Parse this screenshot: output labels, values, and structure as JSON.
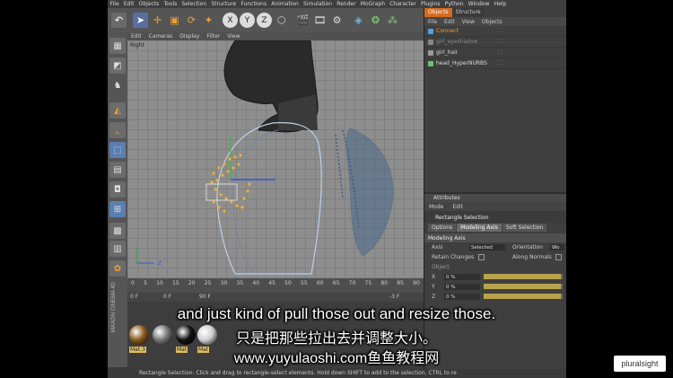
{
  "menubar": [
    "File",
    "Edit",
    "Objects",
    "Tools",
    "Selection",
    "Structure",
    "Functions",
    "Animation",
    "Simulation",
    "Render",
    "MoGraph",
    "Character",
    "Plugins",
    "Python",
    "Window",
    "Help"
  ],
  "viewport": {
    "menu": [
      "Edit",
      "Cameras",
      "Display",
      "Filter",
      "View"
    ],
    "label": "Right",
    "axis_label": "Z"
  },
  "timeline": {
    "ticks": [
      "0",
      "5",
      "10",
      "15",
      "20",
      "25",
      "30",
      "35",
      "40",
      "45",
      "50",
      "55",
      "60",
      "65",
      "70",
      "75",
      "80",
      "85",
      "90"
    ],
    "current_frame": "0 F",
    "start_field": "0 F",
    "end_field": "90 F",
    "right_readout": "-3 F"
  },
  "materials": [
    {
      "label": "Mat.3",
      "color": "#8a5a1e"
    },
    {
      "label": "",
      "color": "#777777"
    },
    {
      "label": "Mat",
      "color": "#111111"
    },
    {
      "label": "Mat",
      "color": "#d0d0d0"
    }
  ],
  "status": "Rectangle Selection: Click and drag to rectangle-select elements. Hold down SHIFT to add to the selection, CTRL to re",
  "objects_panel": {
    "tabs": [
      "Objects",
      "Structure"
    ],
    "menu": [
      "File",
      "Edit",
      "View",
      "Objects"
    ],
    "rows": [
      {
        "name": "Connect",
        "color": "#4fa3e0"
      },
      {
        "name": "girl_eyeshadow",
        "color": "#888888"
      },
      {
        "name": "girl_hair",
        "color": "#9a9a9a"
      },
      {
        "name": "head_HyperNURBS",
        "color": "#6fc07a"
      }
    ]
  },
  "attributes": {
    "header": "Attributes",
    "menu": [
      "Mode",
      "Edit"
    ],
    "title": "Rectangle Selection",
    "tabs": [
      "Options",
      "Modeling Axis",
      "Soft Selection"
    ],
    "section": "Modeling Axis",
    "axis_label": "Axis",
    "axis_value": "Selected",
    "orientation_label": "Orientation",
    "orientation_value": "Wo",
    "retain_label": "Retain Changes",
    "along_normals_label": "Along Normals",
    "object_label": "Object",
    "xyz": [
      {
        "axis": "X",
        "value": "0 %",
        "fraction": 0.98
      },
      {
        "axis": "Y",
        "value": "0 %",
        "fraction": 0.98
      },
      {
        "axis": "Z",
        "value": "0 %",
        "fraction": 0.98
      }
    ]
  },
  "subtitles": {
    "english": "and just kind of pull those out and resize those.",
    "chinese": "只是把那些拉出去并调整大小。",
    "watermark": "www.yuyulaoshi.com鱼鱼教程网"
  },
  "brand": {
    "pluralsight": "pluralsight",
    "cinema": "MAXON CINEMA 4D"
  }
}
